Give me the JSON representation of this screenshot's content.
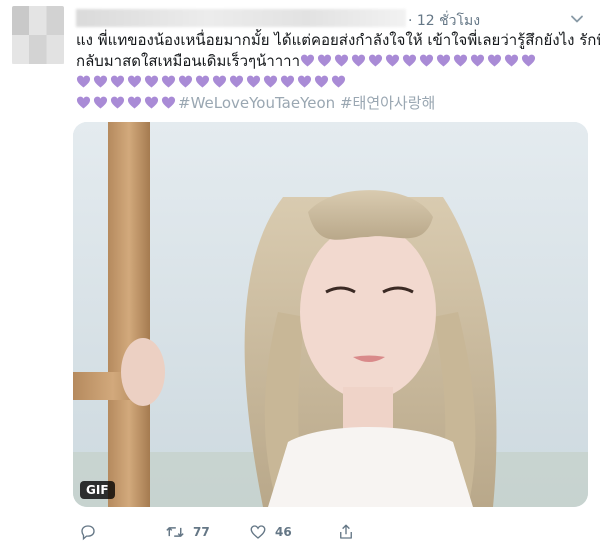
{
  "tweet": {
    "time": "· 12 ชั่วโมง",
    "text": {
      "line1": "แง พี่แทของน้องเหนื่อยมากมั้ย ได้แต่คอยส่งกำลังใจให้ เข้าใจพี่เลยว่ารู้สึกยังไง รักที่สุด",
      "line2": "กลับมาสดใสเหมือนเดิมเร็วๆน้าาาา",
      "hashtag1": "#WeLoveYouTaeYeon",
      "hashtag2": "#태연아사랑해"
    },
    "hearts": {
      "line2_count": 14,
      "line3_count": 6,
      "line3_lead_count": 16,
      "color": "#a98bd6"
    },
    "media": {
      "badge": "GIF"
    },
    "actions": {
      "reply_icon": "reply-icon",
      "retweet_icon": "retweet-icon",
      "retweet_count": "77",
      "like_icon": "heart-icon",
      "like_count": "46",
      "share_icon": "share-icon"
    }
  }
}
